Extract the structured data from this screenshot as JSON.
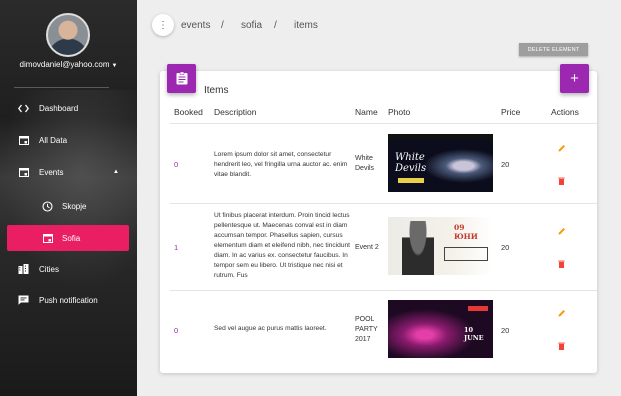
{
  "sidebar": {
    "user_email": "dimovdaniel@yahoo.com",
    "items": [
      {
        "label": "Dashboard",
        "icon": "code-icon"
      },
      {
        "label": "All Data",
        "icon": "calendar-icon"
      },
      {
        "label": "Events",
        "icon": "calendar-icon"
      },
      {
        "label": "Skopje",
        "icon": "clock-icon"
      },
      {
        "label": "Sofia",
        "icon": "calendar-icon"
      },
      {
        "label": "Cities",
        "icon": "city-icon"
      },
      {
        "label": "Push notification",
        "icon": "message-icon"
      }
    ],
    "active_color": "#e91e63"
  },
  "breadcrumb": [
    "events",
    "sofia",
    "items"
  ],
  "breadcrumb_separator": "/",
  "delete_label": "DELETE ELEMENT",
  "card": {
    "title": "Items",
    "add_label": "+",
    "accent": "#9c27b0"
  },
  "table": {
    "headers": [
      "Booked",
      "Description",
      "Name",
      "Photo",
      "Price",
      "Actions"
    ],
    "rows": [
      {
        "booked": "0",
        "description": "Lorem ipsum dolor sit amet, consectetur hendrerit leo, vel fringilla urna auctor ac. enim vitae blandit.",
        "name": "White Devils",
        "photo_text": "White Devils",
        "price": "20"
      },
      {
        "booked": "1",
        "description": "Ut finibus placerat interdum. Proin tincid lectus pellentesque ut. Maecenas conval est in diam accumsan tempor. Phasellus sapien, cursus elementum diam et eleifend nibh, nec tincidunt diam. In ac varius ex. consectetur faucibus. In tempor sem eu libero. Ut tristique nec nisi et rutrum. Fus",
        "name": "Event 2",
        "photo_text": "09 ЮНИ",
        "price": "20"
      },
      {
        "booked": "0",
        "description": "Sed vel augue ac purus mattis laoreet.",
        "name": "POOL PARTY 2017",
        "photo_text": "10 JUNE",
        "price": "20"
      }
    ],
    "edit_color": "#ff9800",
    "delete_color": "#f44336"
  }
}
